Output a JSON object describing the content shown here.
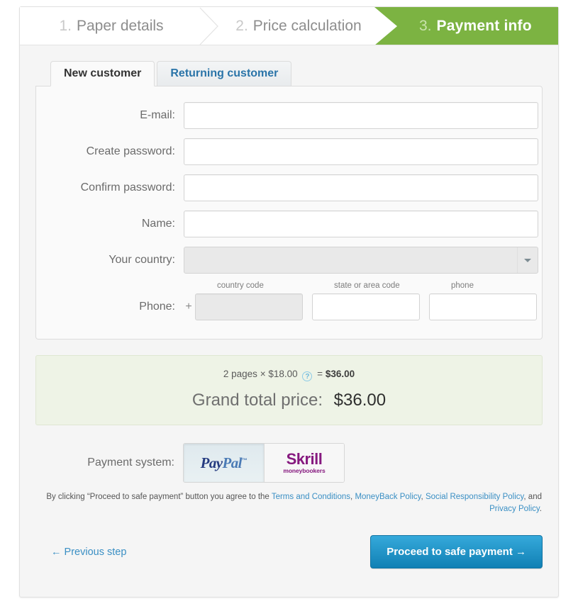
{
  "steps": [
    {
      "num": "1.",
      "label": "Paper details",
      "state": "completed"
    },
    {
      "num": "2.",
      "label": "Price calculation",
      "state": "completed"
    },
    {
      "num": "3.",
      "label": "Payment info",
      "state": "active"
    }
  ],
  "tabs": [
    {
      "label": "New customer",
      "active": true
    },
    {
      "label": "Returning customer",
      "active": false
    }
  ],
  "form": {
    "email": {
      "label": "E-mail:",
      "value": "",
      "placeholder": ""
    },
    "create_password": {
      "label": "Create password:",
      "value": "",
      "placeholder": ""
    },
    "confirm_password": {
      "label": "Confirm password:",
      "value": "",
      "placeholder": ""
    },
    "name": {
      "label": "Name:",
      "value": "",
      "placeholder": ""
    },
    "country": {
      "label": "Your country:",
      "value": "",
      "placeholder": ""
    },
    "phone": {
      "label": "Phone:",
      "plus": "+",
      "country_code": {
        "sublabel": "country code",
        "value": "",
        "placeholder": ""
      },
      "area_code": {
        "sublabel": "state or area code",
        "value": "",
        "placeholder": ""
      },
      "number": {
        "sublabel": "phone",
        "value": "",
        "placeholder": ""
      }
    }
  },
  "price": {
    "pages": "2 pages",
    "times": "×",
    "unit_price": "$18.00",
    "help_icon": "question-mark-icon",
    "equals": "=",
    "subtotal": "$36.00",
    "grand_total_label": "Grand total price:",
    "grand_total": "$36.00"
  },
  "payment": {
    "label": "Payment system:",
    "options": [
      {
        "name": "paypal",
        "primary": "Pay",
        "secondary": "Pal",
        "tm": "™",
        "selected": true
      },
      {
        "name": "skrill",
        "primary": "Skrill",
        "secondary": "moneybookers",
        "selected": false
      }
    ]
  },
  "terms": {
    "prefix": "By clicking “Proceed to safe payment” button you agree to the ",
    "link1": "Terms and Conditions",
    "sep1": ", ",
    "link2": "MoneyBack Policy",
    "sep2": ", ",
    "link3": "Social Responsibility Policy",
    "sep3": ", and ",
    "link4": "Privacy Policy",
    "suffix": "."
  },
  "actions": {
    "previous": "← Previous step",
    "proceed": "Proceed to safe payment →"
  },
  "colors": {
    "active_step_green": "#7cb342",
    "link_blue": "#3a8fc4",
    "button_blue_top": "#35a9db",
    "button_blue_bottom": "#1180b4",
    "price_box_green": "#eef3e6",
    "paypal_dark": "#253b80",
    "paypal_light": "#4a7ab5",
    "skrill_purple": "#86197f"
  }
}
